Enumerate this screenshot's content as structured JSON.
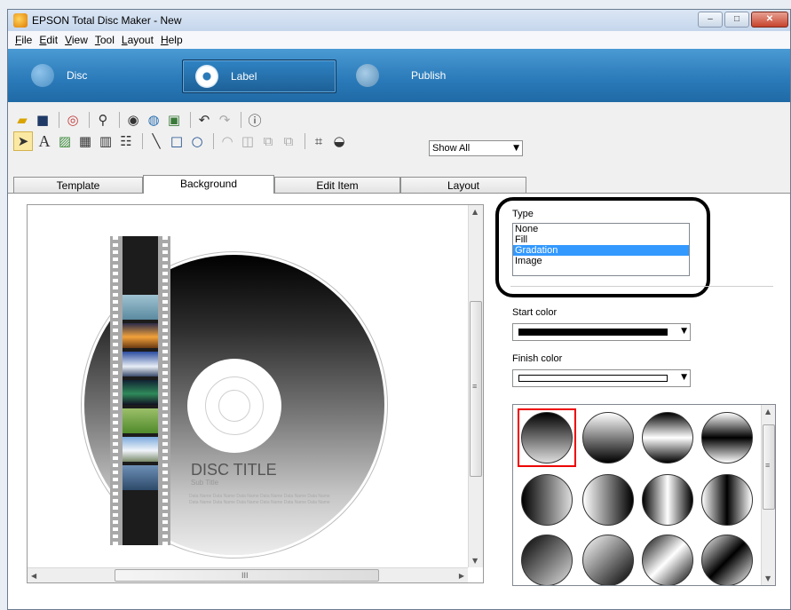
{
  "window": {
    "title": "EPSON Total Disc Maker - New",
    "min_label": "–",
    "max_label": "□",
    "close_label": "✕"
  },
  "menu": [
    "File",
    "Edit",
    "View",
    "Tool",
    "Layout",
    "Help"
  ],
  "modes": {
    "disc": "Disc",
    "label": "Label",
    "publish": "Publish"
  },
  "toolbar2": {
    "show_all": "Show All"
  },
  "tabs": [
    "Template",
    "Background",
    "Edit Item",
    "Layout"
  ],
  "disc": {
    "title": "DISC TITLE",
    "subtitle": "Sub Title",
    "names": "Data Name Data Name Data Name Data Name Data Name Data Name Data Name Data Name Data Name Data Name Data Name Data Name"
  },
  "panel": {
    "type_label": "Type",
    "type_options": [
      "None",
      "Fill",
      "Gradation",
      "Image"
    ],
    "type_selected": "Gradation",
    "start_color_label": "Start color",
    "start_color": "#000000",
    "finish_color_label": "Finish color",
    "finish_color": "#ffffff"
  },
  "scrollbar": {
    "h_grip": "III",
    "v_grip": "≡"
  },
  "accent": {
    "mode_bar": "#2a79b8",
    "selection": "#3399ff",
    "highlight_frame": "#e00000"
  }
}
